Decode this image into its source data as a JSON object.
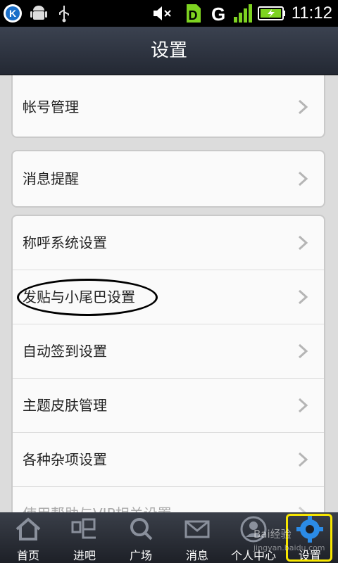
{
  "status_bar": {
    "time": "11:12",
    "icons": [
      "k-app-icon",
      "android-icon",
      "usb-icon",
      "mute-icon",
      "sim-icon",
      "network-g-icon",
      "signal-icon",
      "battery-charging-icon"
    ]
  },
  "title_bar": {
    "title": "设置"
  },
  "settings": {
    "group1": [
      {
        "label": "帐号管理"
      }
    ],
    "group2": [
      {
        "label": "消息提醒"
      }
    ],
    "group3": [
      {
        "label": "称呼系统设置"
      },
      {
        "label": "发贴与小尾巴设置"
      },
      {
        "label": "自动签到设置"
      },
      {
        "label": "主题皮肤管理"
      },
      {
        "label": "各种杂项设置"
      },
      {
        "label": "使用帮助与VIP相关设置"
      }
    ]
  },
  "bottom_nav": {
    "items": [
      {
        "label": "首页",
        "icon": "home-icon"
      },
      {
        "label": "进吧",
        "icon": "ba-icon"
      },
      {
        "label": "广场",
        "icon": "search-icon"
      },
      {
        "label": "消息",
        "icon": "mail-icon"
      },
      {
        "label": "个人中心",
        "icon": "person-icon"
      },
      {
        "label": "设置",
        "icon": "gear-icon"
      }
    ],
    "active_index": 5
  },
  "watermark": {
    "text": "Bai经验",
    "sub": "jingyan.baidu.com"
  },
  "colors": {
    "active_highlight": "#f7e600",
    "title_bar": "#2c313c",
    "nav_bar": "#2b2f38"
  }
}
